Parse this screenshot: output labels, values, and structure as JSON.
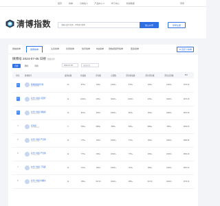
{
  "topnav": {
    "links": [
      "首页",
      "榜单",
      "分类榜 ▾",
      "产品中心 ▾",
      "学习中心",
      "新榜数据"
    ],
    "login": "登录"
  },
  "header": {
    "logo_text": "清博指数",
    "search_placeholder": "请输入账号名称、ID等进行搜索",
    "search_button": "找公众号",
    "login_button": "登录注册"
  },
  "tabs": {
    "items": [
      "微信榜单",
      "微博榜单",
      "头条榜单",
      "抖音榜单",
      "快手榜单",
      "B站榜单",
      "微信视频号榜单",
      "更多榜单"
    ],
    "active_index": 1,
    "right_action": "自定义榜单"
  },
  "ranking": {
    "title": "微博号 2024-07-05 日榜",
    "subtitle": "数据说明",
    "filters": [
      "日榜",
      "周榜",
      "月榜"
    ],
    "active_filter": 0,
    "date": "2024-07-05",
    "group": "选择分组"
  },
  "table": {
    "columns": [
      "排名",
      "微博账号",
      "发博总数",
      "转发数",
      "评论数",
      "点赞数",
      "原创转发数",
      "原创评论数",
      "原创点赞数",
      "BCI"
    ],
    "rows": [
      {
        "rank": "1",
        "name": "微博视频排行榜",
        "id": "3251546666",
        "posts": "23",
        "reposts": "57W+",
        "comments": "12W+",
        "likes": "210W+",
        "orig_reposts": "57W+",
        "orig_comments": "12W+",
        "orig_likes": "210W+",
        "bci": "1702.32"
      },
      {
        "rank": "2",
        "name": "时代少年团-宋亚轩",
        "id": "6009398956",
        "posts": "11",
        "reposts": "100W+",
        "comments": "23W+",
        "likes": "300W+",
        "orig_reposts": "100W+",
        "orig_comments": "23W+",
        "orig_likes": "300W+",
        "bci": "1670.45"
      },
      {
        "rank": "3",
        "name": "时代少年团-贺峻霖",
        "id": "6009380906",
        "posts": "14",
        "reposts": "91W+",
        "comments": "20W+",
        "likes": "290W+",
        "orig_reposts": "91W+",
        "orig_comments": "20W+",
        "orig_likes": "290W+",
        "bci": "1651.08"
      },
      {
        "rank": "4",
        "name": "张海娇",
        "id": "7101144994",
        "posts": "5",
        "reposts": "50W+",
        "comments": "9869+",
        "likes": "89W+",
        "orig_reposts": "50W+",
        "orig_comments": "9869+",
        "orig_likes": "89W+",
        "bci": "1609.63"
      },
      {
        "rank": "5",
        "name": "时代少年团-严浩翔",
        "id": "6009309590",
        "posts": "11",
        "reposts": "77W+",
        "comments": "16W+",
        "likes": "200W+",
        "orig_reposts": "77W+",
        "orig_comments": "16W+",
        "orig_likes": "200W+",
        "bci": "1596.95"
      },
      {
        "rank": "6",
        "name": "时代少年团-严浩翔",
        "id": "7747350258",
        "posts": "11",
        "reposts": "77W+",
        "comments": "16W+",
        "likes": "200W+",
        "orig_reposts": "77W+",
        "orig_comments": "16W+",
        "orig_likes": "200W+",
        "bci": "1594.49"
      },
      {
        "rank": "7",
        "name": "时代少年团-丁程鑫",
        "id": "7730290809",
        "posts": "11",
        "reposts": "71W+",
        "comments": "18W+",
        "likes": "190W+",
        "orig_reposts": "71W+",
        "orig_comments": "18W+",
        "orig_likes": "190W+",
        "bci": "1587.02"
      },
      {
        "rank": "8",
        "name": "时代少年团-刘耀文",
        "id": "6177262713",
        "posts": "11",
        "reposts": "48W+",
        "comments": "62719",
        "likes": "400W+",
        "orig_reposts": "48W+",
        "orig_comments": "62719",
        "orig_likes": "400W+",
        "bci": "1570.11"
      }
    ]
  }
}
